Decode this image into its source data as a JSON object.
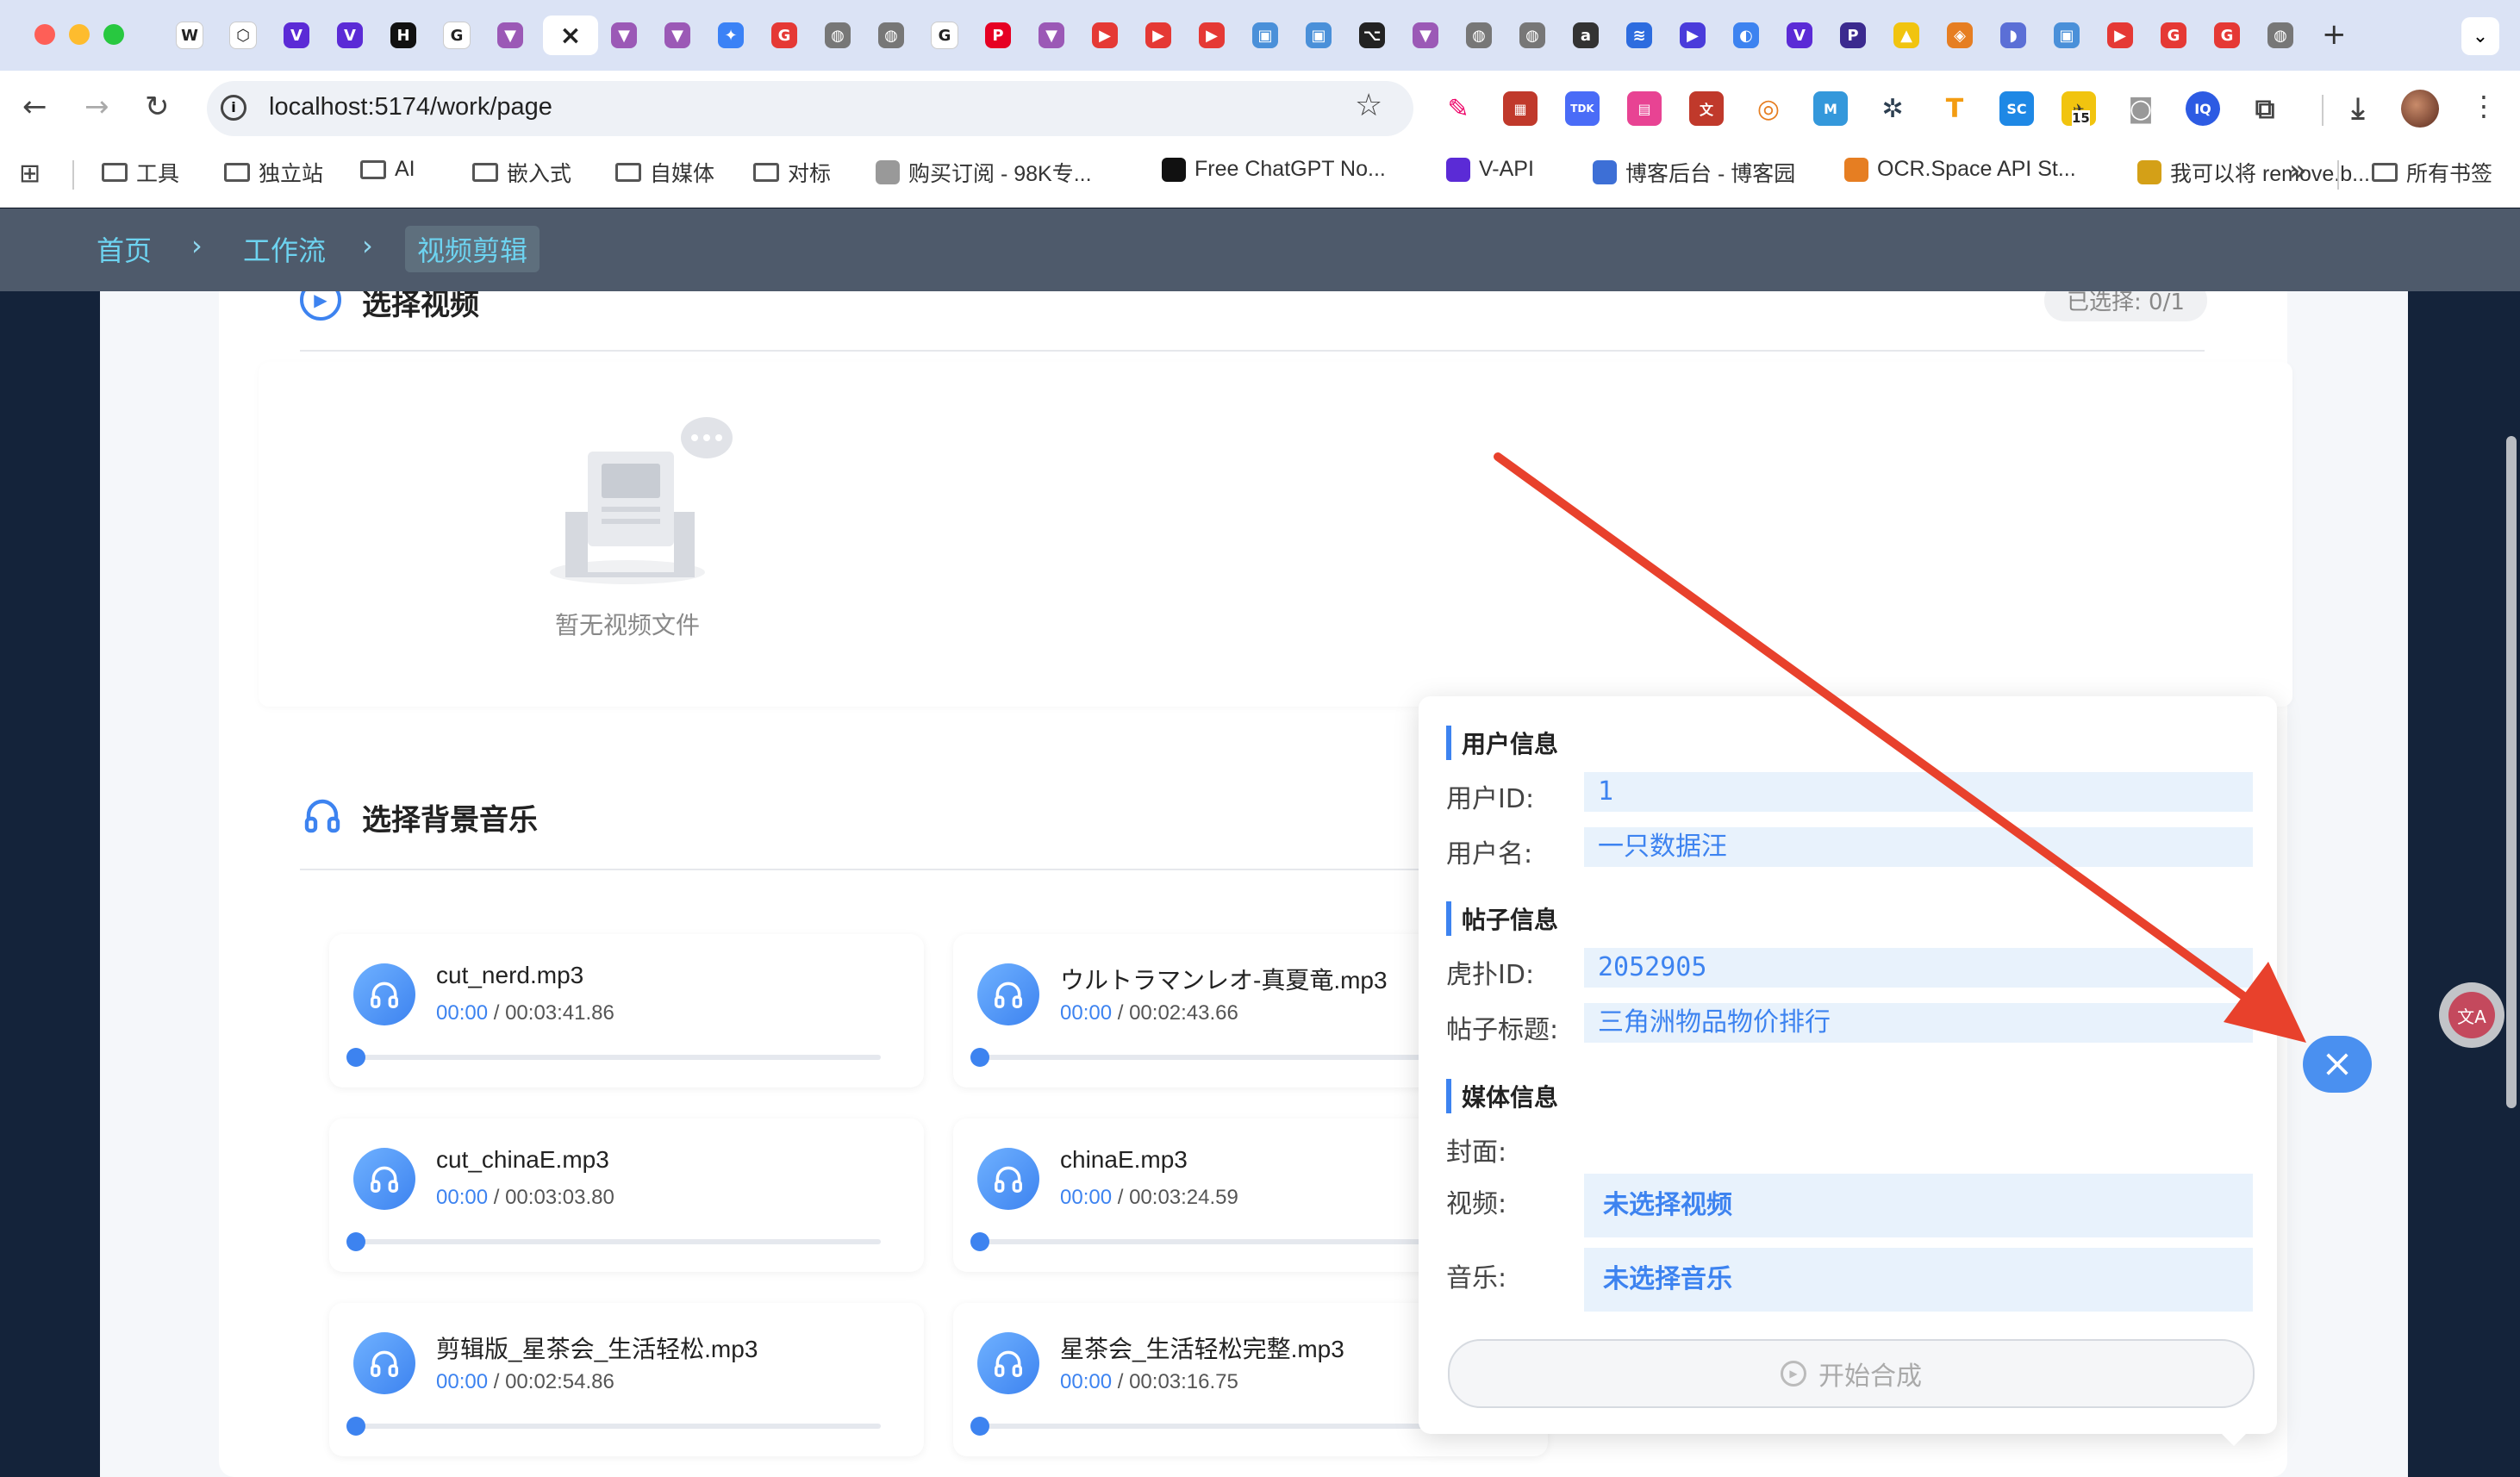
{
  "browser": {
    "url": "localhost:5174/work/page",
    "tabs": [
      "W",
      "⬡",
      "V",
      "V",
      "H",
      "G",
      "▼",
      "×",
      "▼",
      "▼",
      "✦",
      "G",
      "◍",
      "◍",
      "G",
      "P",
      "▼",
      "▶",
      "▶",
      "▶",
      "▣",
      "▣",
      "⌥",
      "▼",
      "◍",
      "◍",
      "a",
      "≋",
      "▶",
      "◐",
      "V",
      "P",
      "▲",
      "◈",
      "◗",
      "▣",
      "▶",
      "G",
      "G",
      "◍"
    ],
    "new_tab": "+",
    "ext_badge": "15",
    "bookmarks": [
      "工具",
      "独立站",
      "AI",
      "嵌入式",
      "自媒体",
      "对标",
      "购买订阅 - 98K专...",
      "Free ChatGPT No...",
      "V-API",
      "博客后台 - 博客园",
      "OCR.Space API St...",
      "我可以将 remove.b..."
    ],
    "bookmarks_more": "»",
    "all_bookmarks": "所有书签"
  },
  "breadcrumb": {
    "home": "首页",
    "sep": "›",
    "workflow": "工作流",
    "current": "视频剪辑"
  },
  "video_section": {
    "title": "选择视频",
    "selected": "已选择: 0/1",
    "empty": "暂无视频文件"
  },
  "music_section": {
    "title": "选择背景音乐",
    "items": [
      {
        "name": "cut_nerd.mp3",
        "current": "00:00",
        "sep": " / ",
        "duration": "00:03:41.86"
      },
      {
        "name": "ウルトラマンレオ-真夏竜.mp3",
        "current": "00:00",
        "sep": " / ",
        "duration": "00:02:43.66"
      },
      {
        "name": "cut_chinaE.mp3",
        "current": "00:00",
        "sep": " / ",
        "duration": "00:03:03.80"
      },
      {
        "name": "chinaE.mp3",
        "current": "00:00",
        "sep": " / ",
        "duration": "00:03:24.59"
      },
      {
        "name": "剪辑版_星茶会_生活轻松.mp3",
        "current": "00:00",
        "sep": " / ",
        "duration": "00:02:54.86"
      },
      {
        "name": "星茶会_生活轻松完整.mp3",
        "current": "00:00",
        "sep": " / ",
        "duration": "00:03:16.75"
      }
    ]
  },
  "info_panel": {
    "user_header": "用户信息",
    "user_id_label": "用户ID:",
    "user_id": "1",
    "username_label": "用户名:",
    "username": "一只数据汪",
    "post_header": "帖子信息",
    "hupu_id_label": "虎扑ID:",
    "hupu_id": "2052905",
    "post_title_label": "帖子标题:",
    "post_title": "三角洲物品物价排行",
    "media_header": "媒体信息",
    "cover_label": "封面:",
    "video_label": "视频:",
    "video_value": "未选择视频",
    "music_label": "音乐:",
    "music_value": "未选择音乐",
    "start_button": "开始合成"
  },
  "colors": {
    "accent": "#3d83f0",
    "arrow": "#e8412c"
  }
}
